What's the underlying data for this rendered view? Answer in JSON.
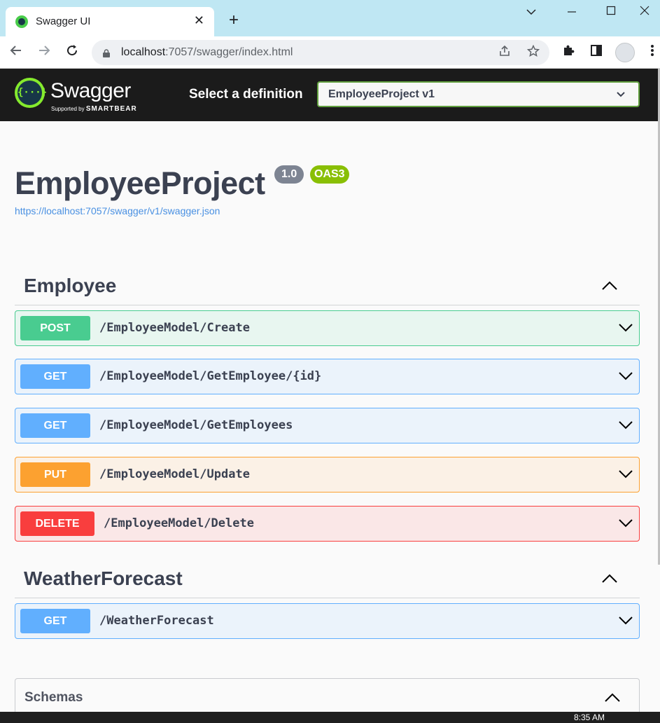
{
  "browser": {
    "tab_title": "Swagger UI",
    "tab_close": "✕",
    "new_tab": "+",
    "url_host": "localhost",
    "url_rest": ":7057/swagger/index.html"
  },
  "topbar": {
    "logo_text": "Swagger",
    "logo_mark": "{···}",
    "logo_sub_prefix": "Supported by",
    "logo_sub_brand": "SMARTBEAR",
    "select_label": "Select a definition",
    "selected_definition": "EmployeeProject v1"
  },
  "info": {
    "title": "EmployeeProject",
    "version": "1.0",
    "oas": "OAS3",
    "spec_url": "https://localhost:7057/swagger/v1/swagger.json"
  },
  "sections": [
    {
      "name": "Employee",
      "operations": [
        {
          "method": "POST",
          "path": "/EmployeeModel/Create"
        },
        {
          "method": "GET",
          "path": "/EmployeeModel/GetEmployee/{id}"
        },
        {
          "method": "GET",
          "path": "/EmployeeModel/GetEmployees"
        },
        {
          "method": "PUT",
          "path": "/EmployeeModel/Update"
        },
        {
          "method": "DELETE",
          "path": "/EmployeeModel/Delete"
        }
      ]
    },
    {
      "name": "WeatherForecast",
      "operations": [
        {
          "method": "GET",
          "path": "/WeatherForecast"
        }
      ]
    }
  ],
  "schemas": {
    "title": "Schemas"
  },
  "taskbar": {
    "clock": "8:35 AM"
  },
  "colors": {
    "post": "#49cc90",
    "get": "#61affe",
    "put": "#fca130",
    "delete": "#f93e3e",
    "accent": "#85ea2d"
  }
}
